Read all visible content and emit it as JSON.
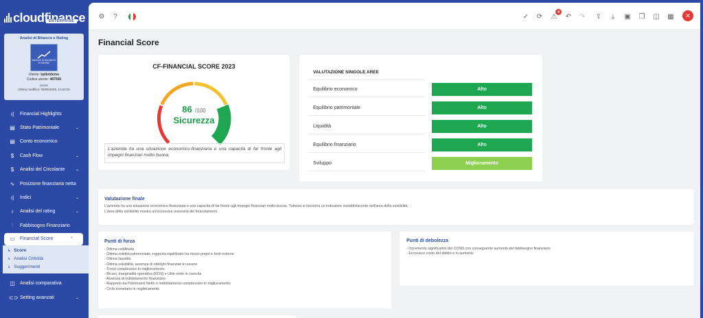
{
  "app": {
    "brand": "cloudfinance",
    "edition": "ENTERPRISE"
  },
  "colors": {
    "primary": "#2c4aa5",
    "green_dark": "#1fa650",
    "green_light": "#8dcf4f",
    "red": "#e53935",
    "orange": "#f5a623",
    "yellow": "#f2c12e"
  },
  "profile": {
    "title": "Analisi di Bilancio e Rating",
    "image_caption": [
      "ANALISI DI BILANCIO",
      "E RATING"
    ],
    "user_label": "Utente:",
    "user": "bpilotdemo",
    "code_label": "Codice utente:",
    "code": "487566",
    "name": "prova",
    "modified_label": "Ultima modifica:",
    "modified": "09/05/2025, 11:52:03"
  },
  "nav": {
    "items_top": [
      {
        "label": "Financial Highlights",
        "icon": "bar-chart-icon"
      },
      {
        "label": "Stato Patrimoniale",
        "icon": "document-icon",
        "chevron": "⌄"
      },
      {
        "label": "Conto economico",
        "icon": "document-icon"
      },
      {
        "label": "Cash Flow",
        "icon": "dollar-icon",
        "chevron": "⌄"
      },
      {
        "label": "Analisi del Circolante",
        "icon": "dollar-icon",
        "chevron": "⌄"
      },
      {
        "label": "Posizione finanziaria netta",
        "icon": "trend-icon"
      },
      {
        "label": "Indici",
        "icon": "bar-chart-icon",
        "chevron": "⌄"
      },
      {
        "label": "Analisi del rating",
        "icon": "award-icon",
        "chevron": "⌄"
      },
      {
        "label": "Fabbisogno Finanziario",
        "icon": "sliders-icon"
      }
    ],
    "active": {
      "label": "Financial Score",
      "icon": "monitor-icon",
      "chevron": "⌃"
    },
    "sub_items": [
      {
        "label": "Score",
        "current": true
      },
      {
        "label": "Analisi Criticità"
      },
      {
        "label": "Suggerimenti"
      }
    ],
    "items_bottom": [
      {
        "label": "Analisi comparativa",
        "icon": "layout-icon"
      },
      {
        "label": "Setting avanzati",
        "icon": "toggle-icon",
        "chevron": "⌄"
      }
    ]
  },
  "toolbar": {
    "language": "Italiano",
    "notifications": "4"
  },
  "page": {
    "title": "Financial Score"
  },
  "score": {
    "title": "CF-FINANCIAL SCORE 2023",
    "value": 86,
    "value_text": "86",
    "max_text": "/100",
    "rating": "Sicurezza",
    "note": "L'azienda ha una situazione economico-finanziaria e una capacità di far fronte agli impegni finanziari molto buona."
  },
  "areas": {
    "header": "VALUTAZIONE SINGOLE AREE",
    "rows": [
      {
        "label": "Equilibrio economico",
        "value": "Alto",
        "level": "high"
      },
      {
        "label": "Equilibrio patrimoniale",
        "value": "Alto",
        "level": "high"
      },
      {
        "label": "Liquidità",
        "value": "Alto",
        "level": "high"
      },
      {
        "label": "Equilibrio finanziario",
        "value": "Alto",
        "level": "high"
      },
      {
        "label": "Sviluppo",
        "value": "Miglioramento",
        "level": "medium"
      }
    ]
  },
  "final": {
    "title": "Valutazione finale",
    "lines": [
      "L'azienda ha una situazione economico-finanziaria e una capacità di far fronte agli impegni finanziari molto buona. Tuttavia si riscontra un indicatore insoddisfacente nell'area della solvibilità.",
      "L'area della solvibilità mostra un'eccessiva onerosità dei finanziamenti."
    ]
  },
  "strengths": {
    "title": "Punti di forza",
    "items": [
      "- Ottima redditività",
      "- Ottima solidità patrimoniale, rapporto equilibrato tra mezzi propri e fonti esterne",
      "- Ottima liquidità",
      "- Ottima solvibilità, assenza di obblighi finanziari in essere",
      "- Trend complessivo in miglioramento",
      "- Ricavi, marginalità operativa (ROS) e Utile netto in crescita",
      "- Assenza di indebitamento finanziario",
      "- Rapporto tra Patrimonio Netto e indebitamento complessivo in miglioramento",
      "- Ciclo monetario in miglioramento"
    ]
  },
  "weaknesses": {
    "title": "Punti di debolezza",
    "items": [
      "- Incremento significativo del CCNO con conseguente aumento del fabbisogno finanziario",
      "- Eccessivo costo del debito e in aumento"
    ]
  }
}
